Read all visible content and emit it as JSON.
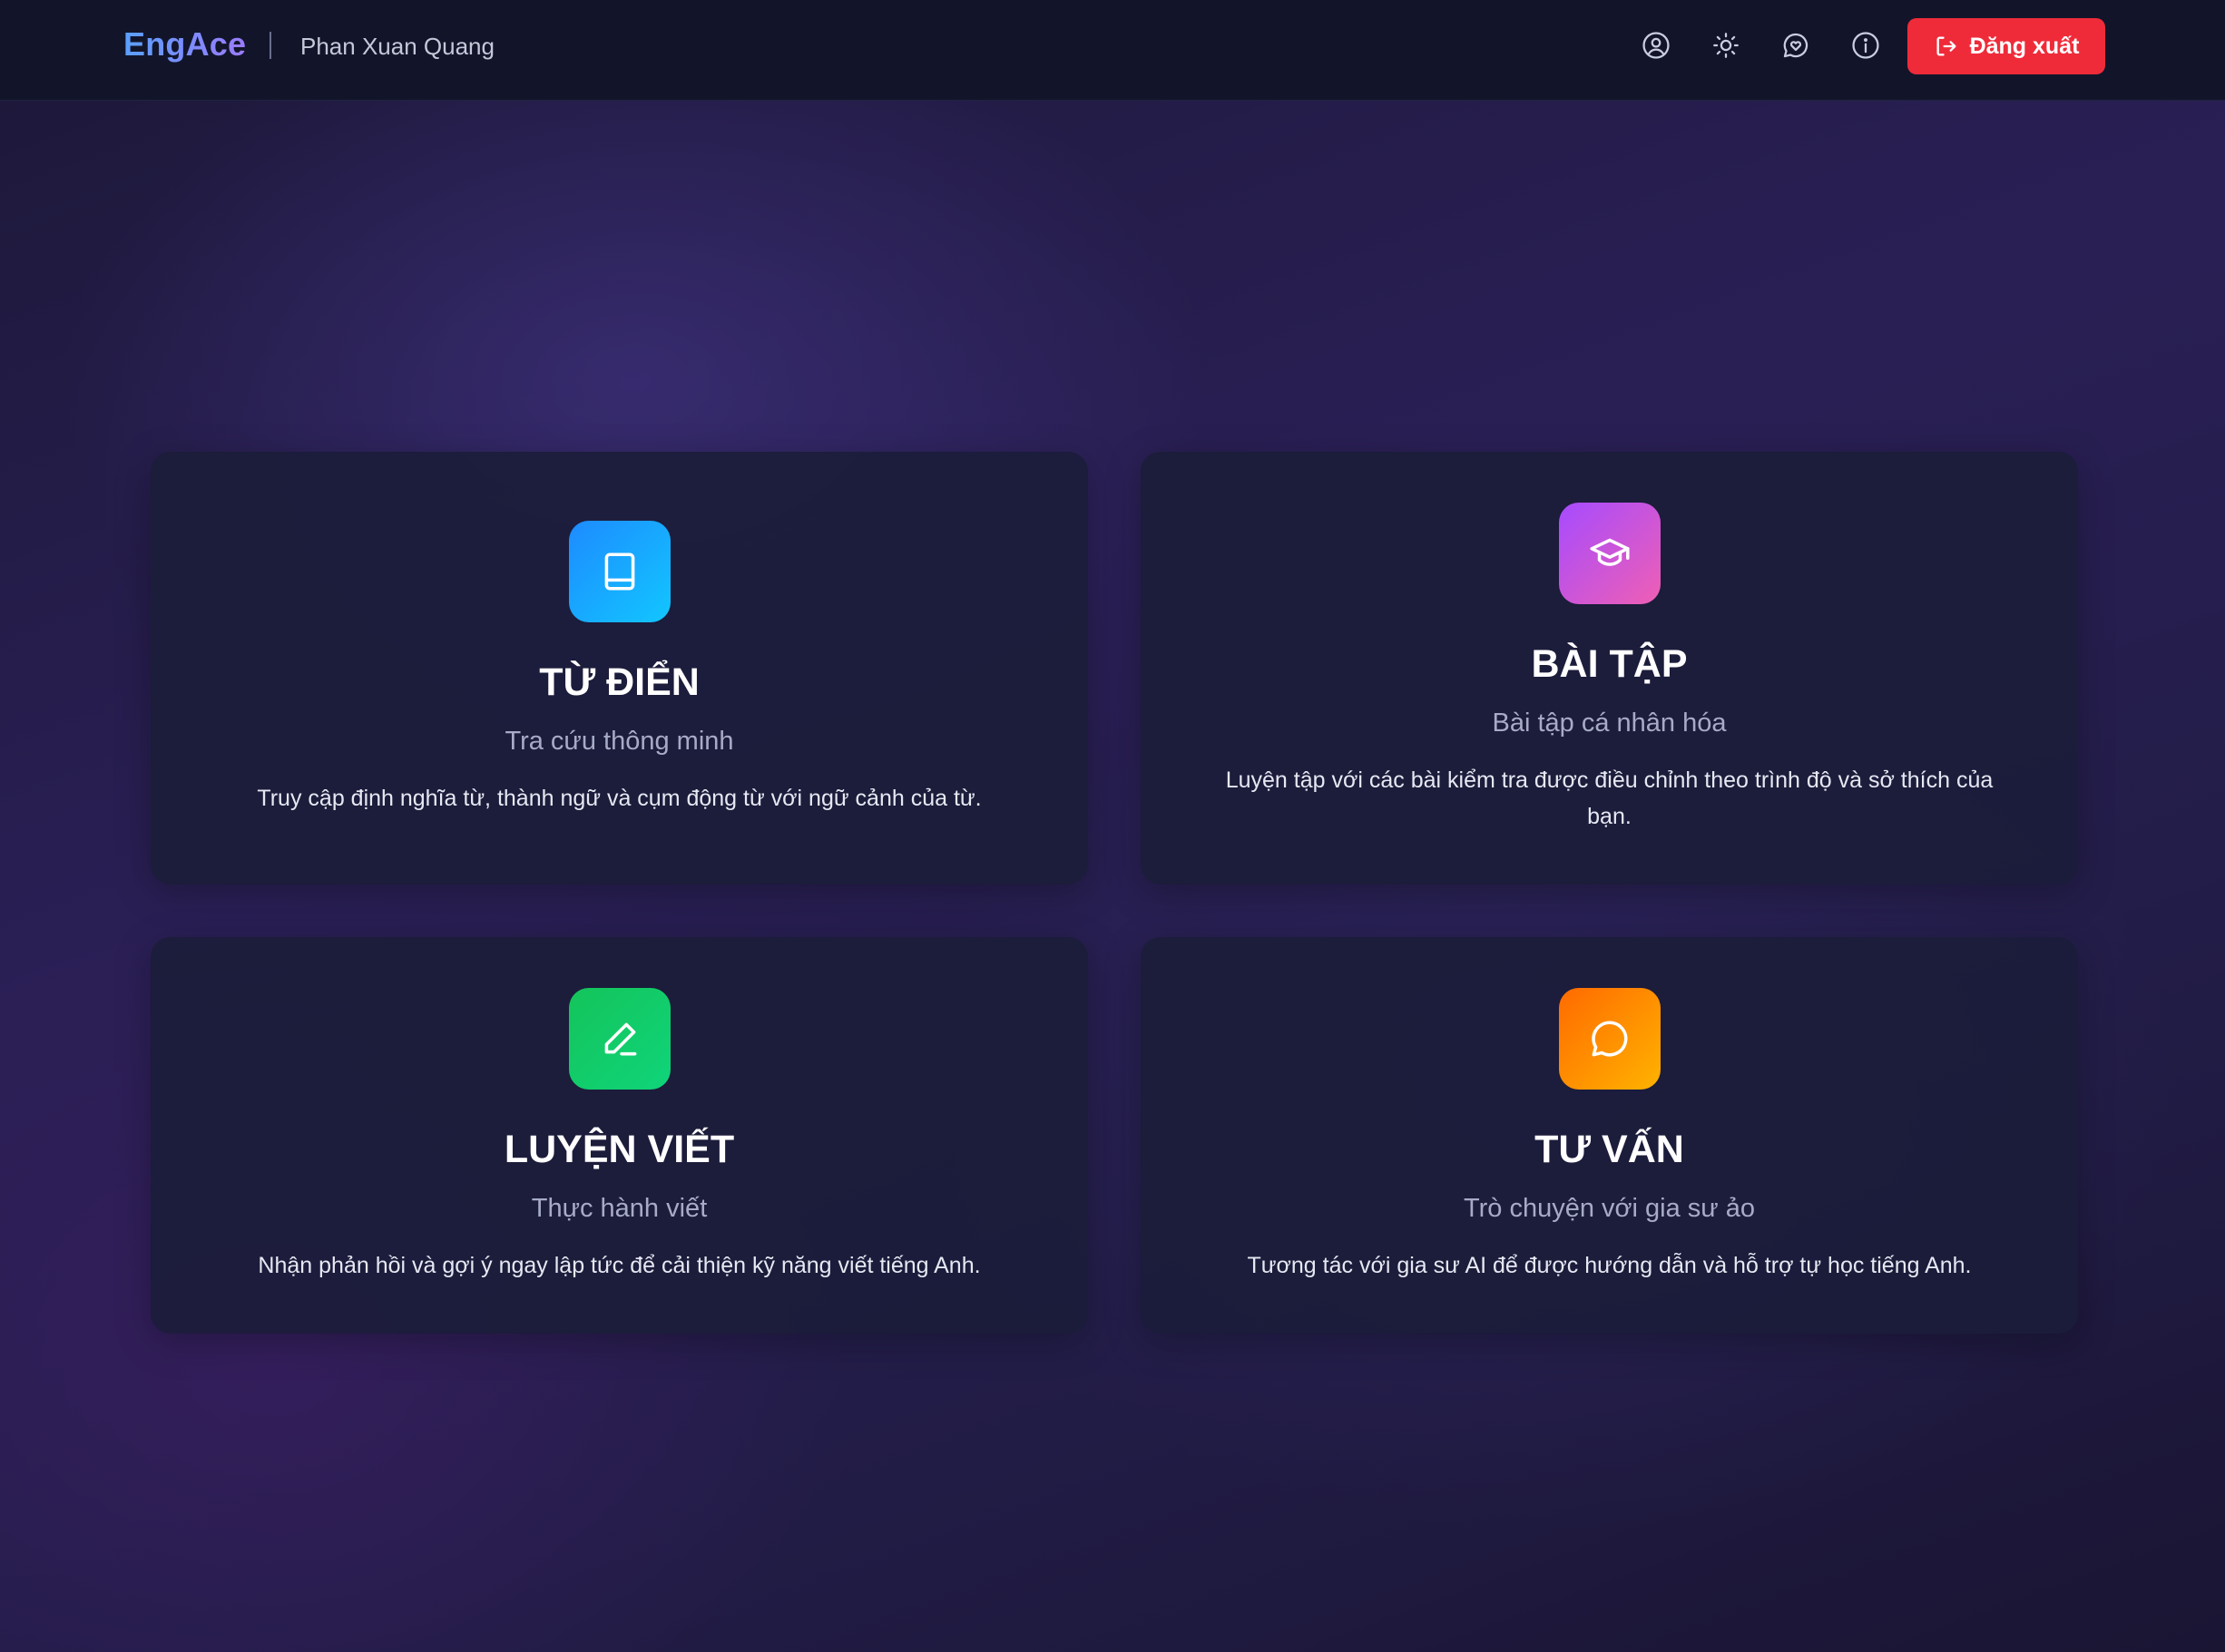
{
  "header": {
    "brand": "EngAce",
    "username": "Phan Xuan Quang",
    "logout_label": "Đăng xuất",
    "icons": [
      "user-circle-icon",
      "sun-icon",
      "chat-heart-icon",
      "info-icon",
      "logout-icon"
    ]
  },
  "cards": [
    {
      "title": "TỪ ĐIỂN",
      "subtitle": "Tra cứu thông minh",
      "description": "Truy cập định nghĩa từ, thành ngữ và cụm động từ với ngữ cảnh của từ.",
      "icon": "book-icon",
      "gradient": [
        "#1d8bff",
        "#12c6ff"
      ]
    },
    {
      "title": "BÀI TẬP",
      "subtitle": "Bài tập cá nhân hóa",
      "description": "Luyện tập với các bài kiểm tra được điều chỉnh theo trình độ và sở thích của bạn.",
      "icon": "graduation-cap-icon",
      "gradient": [
        "#a64bff",
        "#ef5fb4"
      ]
    },
    {
      "title": "LUYỆN VIẾT",
      "subtitle": "Thực hành viết",
      "description": "Nhận phản hồi và gợi ý ngay lập tức để cải thiện kỹ năng viết tiếng Anh.",
      "icon": "pen-icon",
      "gradient": [
        "#14c45a",
        "#0fd47a"
      ]
    },
    {
      "title": "TƯ VẤN",
      "subtitle": "Trò chuyện với gia sư ảo",
      "description": "Tương tác với gia sư AI để được hướng dẫn và hỗ trợ tự học tiếng Anh.",
      "icon": "chat-bubble-icon",
      "gradient": [
        "#ff6a00",
        "#ffb300"
      ]
    }
  ],
  "colors": {
    "header_bg": "#12152a",
    "logout_bg": "#ef2b3a",
    "card_bg": "#1b1c3a"
  }
}
